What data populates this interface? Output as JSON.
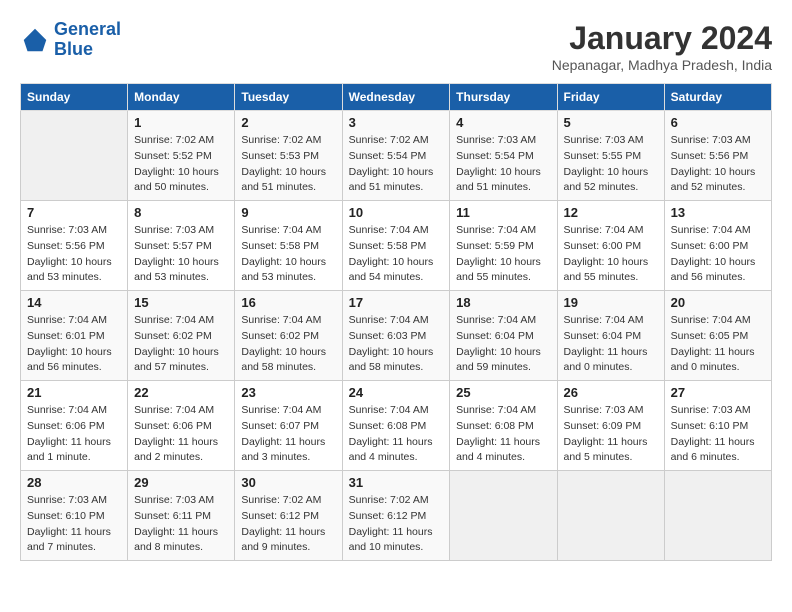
{
  "header": {
    "logo_line1": "General",
    "logo_line2": "Blue",
    "title": "January 2024",
    "location": "Nepanagar, Madhya Pradesh, India"
  },
  "days_of_week": [
    "Sunday",
    "Monday",
    "Tuesday",
    "Wednesday",
    "Thursday",
    "Friday",
    "Saturday"
  ],
  "weeks": [
    [
      {
        "day": "",
        "info": ""
      },
      {
        "day": "1",
        "info": "Sunrise: 7:02 AM\nSunset: 5:52 PM\nDaylight: 10 hours\nand 50 minutes."
      },
      {
        "day": "2",
        "info": "Sunrise: 7:02 AM\nSunset: 5:53 PM\nDaylight: 10 hours\nand 51 minutes."
      },
      {
        "day": "3",
        "info": "Sunrise: 7:02 AM\nSunset: 5:54 PM\nDaylight: 10 hours\nand 51 minutes."
      },
      {
        "day": "4",
        "info": "Sunrise: 7:03 AM\nSunset: 5:54 PM\nDaylight: 10 hours\nand 51 minutes."
      },
      {
        "day": "5",
        "info": "Sunrise: 7:03 AM\nSunset: 5:55 PM\nDaylight: 10 hours\nand 52 minutes."
      },
      {
        "day": "6",
        "info": "Sunrise: 7:03 AM\nSunset: 5:56 PM\nDaylight: 10 hours\nand 52 minutes."
      }
    ],
    [
      {
        "day": "7",
        "info": "Sunrise: 7:03 AM\nSunset: 5:56 PM\nDaylight: 10 hours\nand 53 minutes."
      },
      {
        "day": "8",
        "info": "Sunrise: 7:03 AM\nSunset: 5:57 PM\nDaylight: 10 hours\nand 53 minutes."
      },
      {
        "day": "9",
        "info": "Sunrise: 7:04 AM\nSunset: 5:58 PM\nDaylight: 10 hours\nand 53 minutes."
      },
      {
        "day": "10",
        "info": "Sunrise: 7:04 AM\nSunset: 5:58 PM\nDaylight: 10 hours\nand 54 minutes."
      },
      {
        "day": "11",
        "info": "Sunrise: 7:04 AM\nSunset: 5:59 PM\nDaylight: 10 hours\nand 55 minutes."
      },
      {
        "day": "12",
        "info": "Sunrise: 7:04 AM\nSunset: 6:00 PM\nDaylight: 10 hours\nand 55 minutes."
      },
      {
        "day": "13",
        "info": "Sunrise: 7:04 AM\nSunset: 6:00 PM\nDaylight: 10 hours\nand 56 minutes."
      }
    ],
    [
      {
        "day": "14",
        "info": "Sunrise: 7:04 AM\nSunset: 6:01 PM\nDaylight: 10 hours\nand 56 minutes."
      },
      {
        "day": "15",
        "info": "Sunrise: 7:04 AM\nSunset: 6:02 PM\nDaylight: 10 hours\nand 57 minutes."
      },
      {
        "day": "16",
        "info": "Sunrise: 7:04 AM\nSunset: 6:02 PM\nDaylight: 10 hours\nand 58 minutes."
      },
      {
        "day": "17",
        "info": "Sunrise: 7:04 AM\nSunset: 6:03 PM\nDaylight: 10 hours\nand 58 minutes."
      },
      {
        "day": "18",
        "info": "Sunrise: 7:04 AM\nSunset: 6:04 PM\nDaylight: 10 hours\nand 59 minutes."
      },
      {
        "day": "19",
        "info": "Sunrise: 7:04 AM\nSunset: 6:04 PM\nDaylight: 11 hours\nand 0 minutes."
      },
      {
        "day": "20",
        "info": "Sunrise: 7:04 AM\nSunset: 6:05 PM\nDaylight: 11 hours\nand 0 minutes."
      }
    ],
    [
      {
        "day": "21",
        "info": "Sunrise: 7:04 AM\nSunset: 6:06 PM\nDaylight: 11 hours\nand 1 minute."
      },
      {
        "day": "22",
        "info": "Sunrise: 7:04 AM\nSunset: 6:06 PM\nDaylight: 11 hours\nand 2 minutes."
      },
      {
        "day": "23",
        "info": "Sunrise: 7:04 AM\nSunset: 6:07 PM\nDaylight: 11 hours\nand 3 minutes."
      },
      {
        "day": "24",
        "info": "Sunrise: 7:04 AM\nSunset: 6:08 PM\nDaylight: 11 hours\nand 4 minutes."
      },
      {
        "day": "25",
        "info": "Sunrise: 7:04 AM\nSunset: 6:08 PM\nDaylight: 11 hours\nand 4 minutes."
      },
      {
        "day": "26",
        "info": "Sunrise: 7:03 AM\nSunset: 6:09 PM\nDaylight: 11 hours\nand 5 minutes."
      },
      {
        "day": "27",
        "info": "Sunrise: 7:03 AM\nSunset: 6:10 PM\nDaylight: 11 hours\nand 6 minutes."
      }
    ],
    [
      {
        "day": "28",
        "info": "Sunrise: 7:03 AM\nSunset: 6:10 PM\nDaylight: 11 hours\nand 7 minutes."
      },
      {
        "day": "29",
        "info": "Sunrise: 7:03 AM\nSunset: 6:11 PM\nDaylight: 11 hours\nand 8 minutes."
      },
      {
        "day": "30",
        "info": "Sunrise: 7:02 AM\nSunset: 6:12 PM\nDaylight: 11 hours\nand 9 minutes."
      },
      {
        "day": "31",
        "info": "Sunrise: 7:02 AM\nSunset: 6:12 PM\nDaylight: 11 hours\nand 10 minutes."
      },
      {
        "day": "",
        "info": ""
      },
      {
        "day": "",
        "info": ""
      },
      {
        "day": "",
        "info": ""
      }
    ]
  ]
}
